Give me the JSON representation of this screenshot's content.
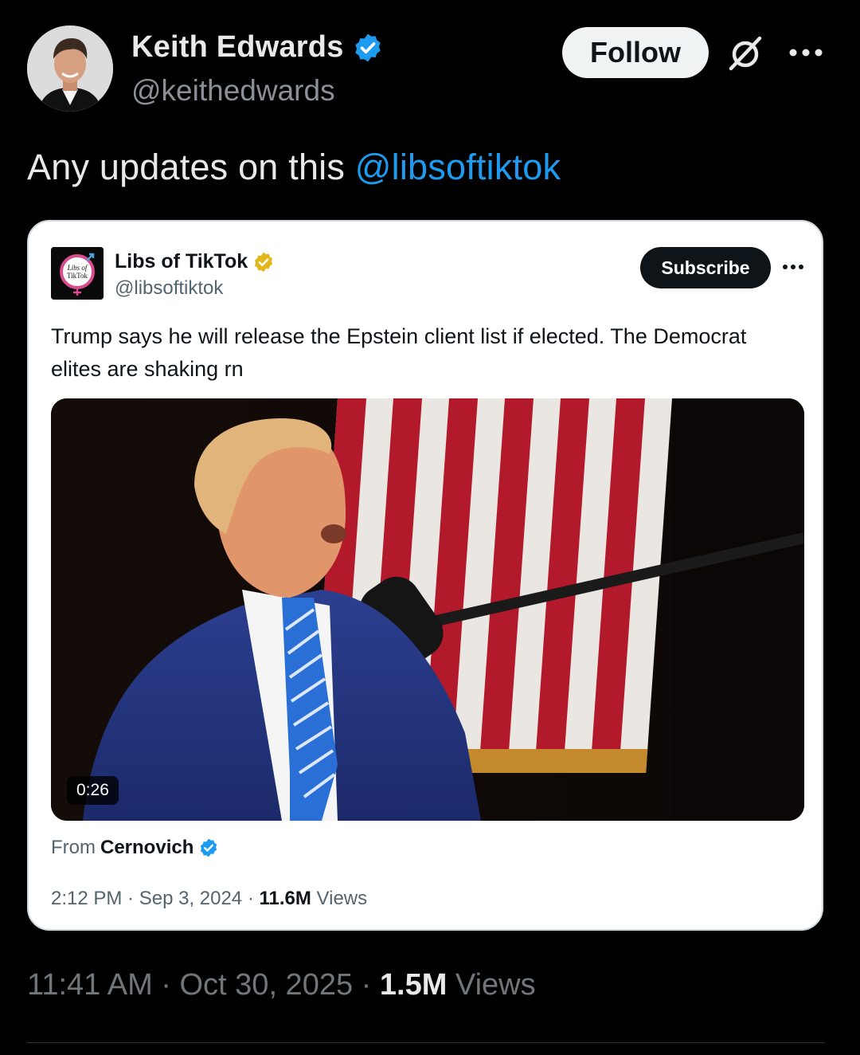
{
  "author": {
    "display_name": "Keith Edwards",
    "handle": "@keithedwards",
    "verified_color": "#1d9bf0",
    "avatar_icon": "avatar-photo"
  },
  "actions": {
    "follow_label": "Follow",
    "grok_icon": "grok-icon",
    "more_icon": "more-icon"
  },
  "tweet": {
    "text": "Any updates on this ",
    "mention": "@libsoftiktok",
    "timestamp": "11:41 AM · Oct 30, 2025 · ",
    "views_count": "1.5M",
    "views_label": " Views"
  },
  "quote": {
    "display_name": "Libs of TikTok",
    "handle": "@libsoftiktok",
    "verified_color": "#e2b719",
    "avatar_text_1": "Libs of",
    "avatar_text_2": "TikTok",
    "subscribe_label": "Subscribe",
    "text": "Trump says he will release the Epstein client list if elected. The Democrat elites are shaking rn",
    "video_duration": "0:26",
    "from_prefix": "From ",
    "from_name": "Cernovich",
    "timestamp": "2:12 PM · Sep 3, 2024 · ",
    "views_count": "11.6M",
    "views_label": " Views"
  },
  "colors": {
    "background": "#000000",
    "accent": "#1d9bf0",
    "text_primary": "#e7e9ea",
    "text_secondary": "#71767b"
  }
}
